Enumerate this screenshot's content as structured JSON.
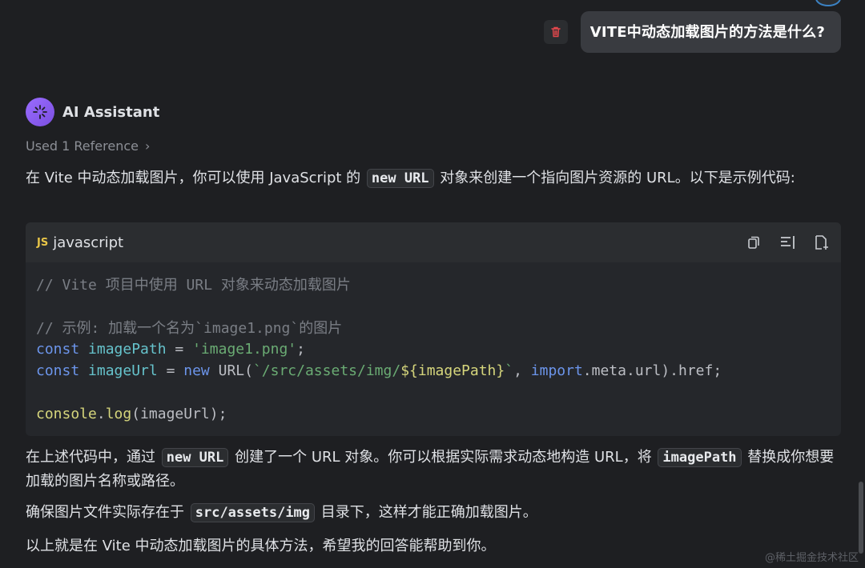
{
  "user_message": {
    "text": "VITE中动态加载图片的方法是什么?"
  },
  "assistant": {
    "name": "AI Assistant",
    "reference_label": "Used 1 Reference",
    "intro": {
      "before": "在 Vite 中动态加载图片，你可以使用 JavaScript 的 ",
      "code": "new URL",
      "after": " 对象来创建一个指向图片资源的 URL。以下是示例代码:"
    },
    "code_block": {
      "language_badge": "JS",
      "language": "javascript",
      "lines": {
        "l1": "// Vite 项目中使用 URL 对象来动态加载图片",
        "l3": "// 示例: 加载一个名为`image1.png`的图片",
        "l4_kw": "const",
        "l4_var": "imagePath",
        "l4_eq": " = ",
        "l4_str": "'image1.png'",
        "l4_end": ";",
        "l5_kw": "const",
        "l5_var": "imageUrl",
        "l5_eq": " = ",
        "l5_new": "new",
        "l5_url": " URL(",
        "l5_str1": "`/src/assets/img/",
        "l5_tpl": "${imagePath}",
        "l5_str2": "`",
        "l5_comma": ", ",
        "l5_import": "import",
        "l5_meta": ".meta.url).href;",
        "l7_fn1": "console",
        "l7_dot": ".",
        "l7_fn2": "log",
        "l7_rest": "(imageUrl);"
      }
    },
    "para2": {
      "p1": "在上述代码中，通过 ",
      "code1": "new URL",
      "p2": " 创建了一个 URL 对象。你可以根据实际需求动态地构造 URL，将 ",
      "code2": "imagePath",
      "p3": " 替换成你想要加载的图片名称或路径。"
    },
    "para3": {
      "p1": "确保图片文件实际存在于 ",
      "code1": "src/assets/img",
      "p2": " 目录下，这样才能正确加载图片。"
    },
    "para4": "以上就是在 Vite 中动态加载图片的具体方法，希望我的回答能帮助到你。"
  },
  "watermark": "@稀土掘金技术社区",
  "colors": {
    "background": "#1e1f22",
    "accent_avatar": "#9a6cff",
    "delete_icon": "#e5484d"
  },
  "icons": [
    "trash-icon",
    "sparkle-icon",
    "chevron-right-icon",
    "copy-icon",
    "insert-at-caret-icon",
    "new-file-icon"
  ]
}
